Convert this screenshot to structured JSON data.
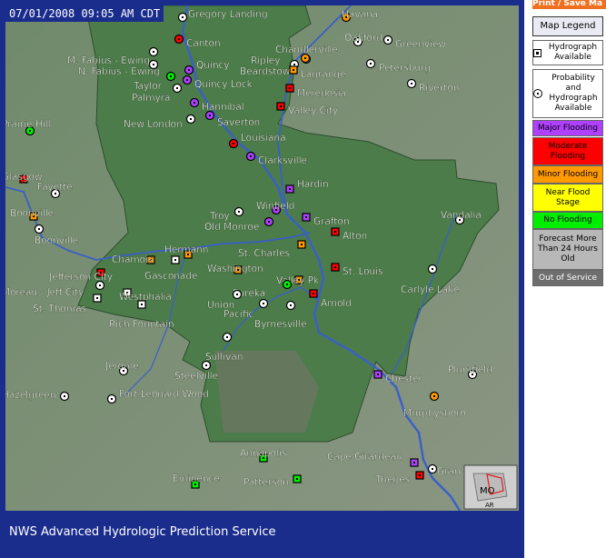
{
  "header": {
    "timestamp": "07/01/2008 09:05 AM CDT"
  },
  "footer": {
    "service_name": "NWS Advanced Hydrologic Prediction Service"
  },
  "toolbar": {
    "print_label": "Print / Save Ma"
  },
  "legend": {
    "button_label": "Map Legend",
    "hydrograph": "Hydrograph Available",
    "probability": "Probability and Hydrograph Available",
    "items": [
      {
        "label": "Major Flooding",
        "color": "#b040ff"
      },
      {
        "label": "Moderate Flooding",
        "color": "#ff0000"
      },
      {
        "label": "Minor Flooding",
        "color": "#ff9900"
      },
      {
        "label": "Near Flood Stage",
        "color": "#ffff00"
      },
      {
        "label": "No Flooding",
        "color": "#00ee00"
      },
      {
        "label": "Forecast More Than 24 Hours Old",
        "color": "#b8b8b8"
      },
      {
        "label": "Out of Service",
        "color": "#6e6e6e"
      }
    ]
  },
  "inset": {
    "state_label": "MO",
    "neighbor_label": "AR"
  },
  "gauges": [
    {
      "name": "Havana",
      "status": "minor",
      "shape": "circle"
    },
    {
      "name": "Oakford",
      "status": "none",
      "shape": "circle"
    },
    {
      "name": "Greenview",
      "status": "none",
      "shape": "circle"
    },
    {
      "name": "Gregory Landing",
      "status": "none",
      "shape": "circle"
    },
    {
      "name": "Canton",
      "status": "moderate",
      "shape": "circle"
    },
    {
      "name": "Chandlerville",
      "status": "none",
      "shape": "circle"
    },
    {
      "name": "M. Fabius - Ewing",
      "status": "none",
      "shape": "circle"
    },
    {
      "name": "N. Fabius - Ewing",
      "status": "none",
      "shape": "circle"
    },
    {
      "name": "Ripley",
      "status": "minor",
      "shape": "circle"
    },
    {
      "name": "Beardstown",
      "status": "none",
      "shape": "circle"
    },
    {
      "name": "Petersburg",
      "status": "none",
      "shape": "circle"
    },
    {
      "name": "Quincy",
      "status": "major",
      "shape": "circle"
    },
    {
      "name": "Lagrange",
      "status": "minor",
      "shape": "square"
    },
    {
      "name": "Taylor",
      "status": "no",
      "shape": "circle"
    },
    {
      "name": "Quincy Lock",
      "status": "major",
      "shape": "circle"
    },
    {
      "name": "Palmyra",
      "status": "none",
      "shape": "circle"
    },
    {
      "name": "Meredosia",
      "status": "moderate",
      "shape": "square"
    },
    {
      "name": "Riverton",
      "status": "none",
      "shape": "circle"
    },
    {
      "name": "Hannibal",
      "status": "major",
      "shape": "circle"
    },
    {
      "name": "Valley City",
      "status": "moderate",
      "shape": "square"
    },
    {
      "name": "Saverton",
      "status": "major",
      "shape": "circle"
    },
    {
      "name": "New London",
      "status": "none",
      "shape": "circle"
    },
    {
      "name": "Prairie Hill",
      "status": "no",
      "shape": "circle"
    },
    {
      "name": "Louisiana",
      "status": "moderate",
      "shape": "circle"
    },
    {
      "name": "Clarksville",
      "status": "major",
      "shape": "circle"
    },
    {
      "name": "Glasgow",
      "status": "moderate",
      "shape": "square"
    },
    {
      "name": "Fayette",
      "status": "none",
      "shape": "circle"
    },
    {
      "name": "Hardin",
      "status": "major",
      "shape": "square"
    },
    {
      "name": "Winfield",
      "status": "major",
      "shape": "circle"
    },
    {
      "name": "Boonville",
      "status": "minor",
      "shape": "square"
    },
    {
      "name": "Troy",
      "status": "none",
      "shape": "circle"
    },
    {
      "name": "Grafton",
      "status": "major",
      "shape": "square"
    },
    {
      "name": "Vandalia",
      "status": "none",
      "shape": "circle"
    },
    {
      "name": "Old Monroe",
      "status": "major",
      "shape": "circle"
    },
    {
      "name": "Alton",
      "status": "moderate",
      "shape": "square"
    },
    {
      "name": "Boonville",
      "status": "none",
      "shape": "circle"
    },
    {
      "name": "Hermann",
      "status": "minor",
      "shape": "square"
    },
    {
      "name": "St. Charles",
      "status": "minor",
      "shape": "square"
    },
    {
      "name": "Chamois",
      "status": "minor",
      "shape": "square"
    },
    {
      "name": "Gasconade",
      "status": "none",
      "shape": "square"
    },
    {
      "name": "Washington",
      "status": "minor",
      "shape": "square"
    },
    {
      "name": "Jefferson City",
      "status": "moderate",
      "shape": "square"
    },
    {
      "name": "St. Louis",
      "status": "moderate",
      "shape": "square"
    },
    {
      "name": "Valley Pk",
      "status": "minor",
      "shape": "square"
    },
    {
      "name": "Carlyle Lake",
      "status": "none",
      "shape": "circle"
    },
    {
      "name": "Moreau - Jeff City",
      "status": "none",
      "shape": "circle"
    },
    {
      "name": "Westphalia",
      "status": "none",
      "shape": "square"
    },
    {
      "name": "Eureka",
      "status": "no",
      "shape": "circle"
    },
    {
      "name": "Arnold",
      "status": "moderate",
      "shape": "square"
    },
    {
      "name": "St. Thomas",
      "status": "none",
      "shape": "square"
    },
    {
      "name": "Union",
      "status": "none",
      "shape": "circle"
    },
    {
      "name": "Pacific",
      "status": "none",
      "shape": "circle"
    },
    {
      "name": "Rich Fountain",
      "status": "none",
      "shape": "square"
    },
    {
      "name": "Byrnesville",
      "status": "none",
      "shape": "circle"
    },
    {
      "name": "Sullivan",
      "status": "none",
      "shape": "circle"
    },
    {
      "name": "Jerome",
      "status": "none",
      "shape": "circle"
    },
    {
      "name": "Steelville",
      "status": "none",
      "shape": "circle"
    },
    {
      "name": "Plumfield",
      "status": "none",
      "shape": "circle"
    },
    {
      "name": "Chester",
      "status": "major",
      "shape": "square"
    },
    {
      "name": "Hazelgreen",
      "status": "none",
      "shape": "circle"
    },
    {
      "name": "Fort Leonard Wood",
      "status": "none",
      "shape": "circle"
    },
    {
      "name": "Murphysboro",
      "status": "minor",
      "shape": "circle"
    },
    {
      "name": "Annapolis",
      "status": "no",
      "shape": "square"
    },
    {
      "name": "Cape Girardeau",
      "status": "major",
      "shape": "square"
    },
    {
      "name": "Eminence",
      "status": "no",
      "shape": "square"
    },
    {
      "name": "Patterson",
      "status": "no",
      "shape": "square"
    },
    {
      "name": "Thebes",
      "status": "moderate",
      "shape": "square"
    },
    {
      "name": "Gran",
      "status": "none",
      "shape": "circle"
    }
  ]
}
